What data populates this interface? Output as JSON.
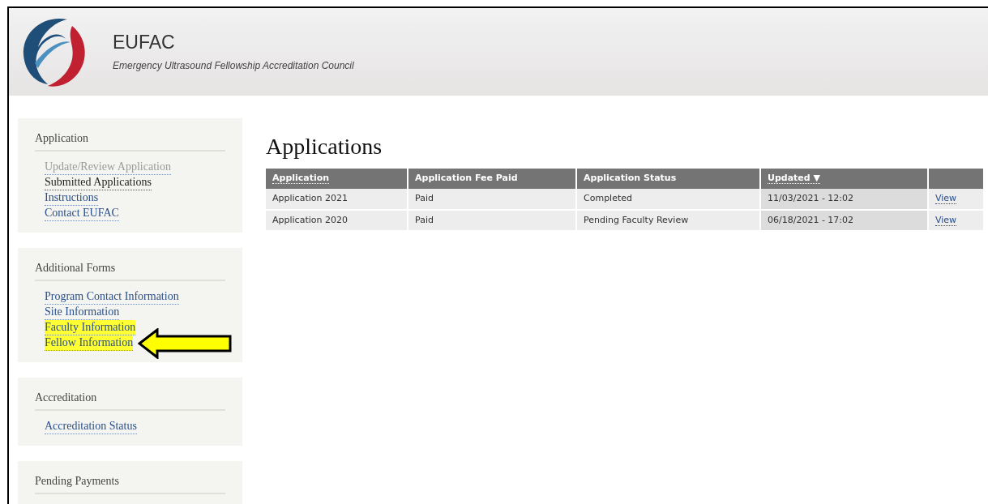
{
  "header": {
    "title": "EUFAC",
    "subtitle": "Emergency Ultrasound Fellowship Accreditation Council"
  },
  "sidebar": [
    {
      "heading": "Application",
      "items": [
        {
          "label": "Update/Review Application",
          "disabled": true,
          "selected": false,
          "highlighted": false
        },
        {
          "label": "Submitted Applications",
          "disabled": false,
          "selected": true,
          "highlighted": false
        },
        {
          "label": "Instructions",
          "disabled": false,
          "selected": false,
          "highlighted": false
        },
        {
          "label": "Contact EUFAC",
          "disabled": false,
          "selected": false,
          "highlighted": false
        }
      ]
    },
    {
      "heading": "Additional Forms",
      "items": [
        {
          "label": "Program Contact Information",
          "disabled": false,
          "selected": false,
          "highlighted": false
        },
        {
          "label": "Site Information",
          "disabled": false,
          "selected": false,
          "highlighted": false
        },
        {
          "label": "Faculty Information",
          "disabled": false,
          "selected": false,
          "highlighted": true
        },
        {
          "label": "Fellow Information",
          "disabled": false,
          "selected": false,
          "highlighted": true,
          "pointer_arrow": true
        }
      ]
    },
    {
      "heading": "Accreditation",
      "items": [
        {
          "label": "Accreditation Status",
          "disabled": false,
          "selected": false,
          "highlighted": false
        }
      ]
    },
    {
      "heading": "Pending Payments"
    }
  ],
  "main": {
    "title": "Applications",
    "table": {
      "columns": [
        {
          "label": "Application",
          "sortable": true,
          "sorted": false
        },
        {
          "label": "Application Fee Paid",
          "sortable": false,
          "sorted": false
        },
        {
          "label": "Application Status",
          "sortable": false,
          "sorted": false
        },
        {
          "label": "Updated",
          "sortable": true,
          "sorted": true,
          "sort_indicator": "▼"
        }
      ],
      "rows": [
        {
          "cells": [
            "Application 2021",
            "Paid",
            "Completed",
            "11/03/2021 - 12:02"
          ],
          "link": "View"
        },
        {
          "cells": [
            "Application 2020",
            "Paid",
            "Pending Faculty Review",
            "06/18/2021 - 17:02"
          ],
          "link": "View"
        }
      ]
    }
  }
}
